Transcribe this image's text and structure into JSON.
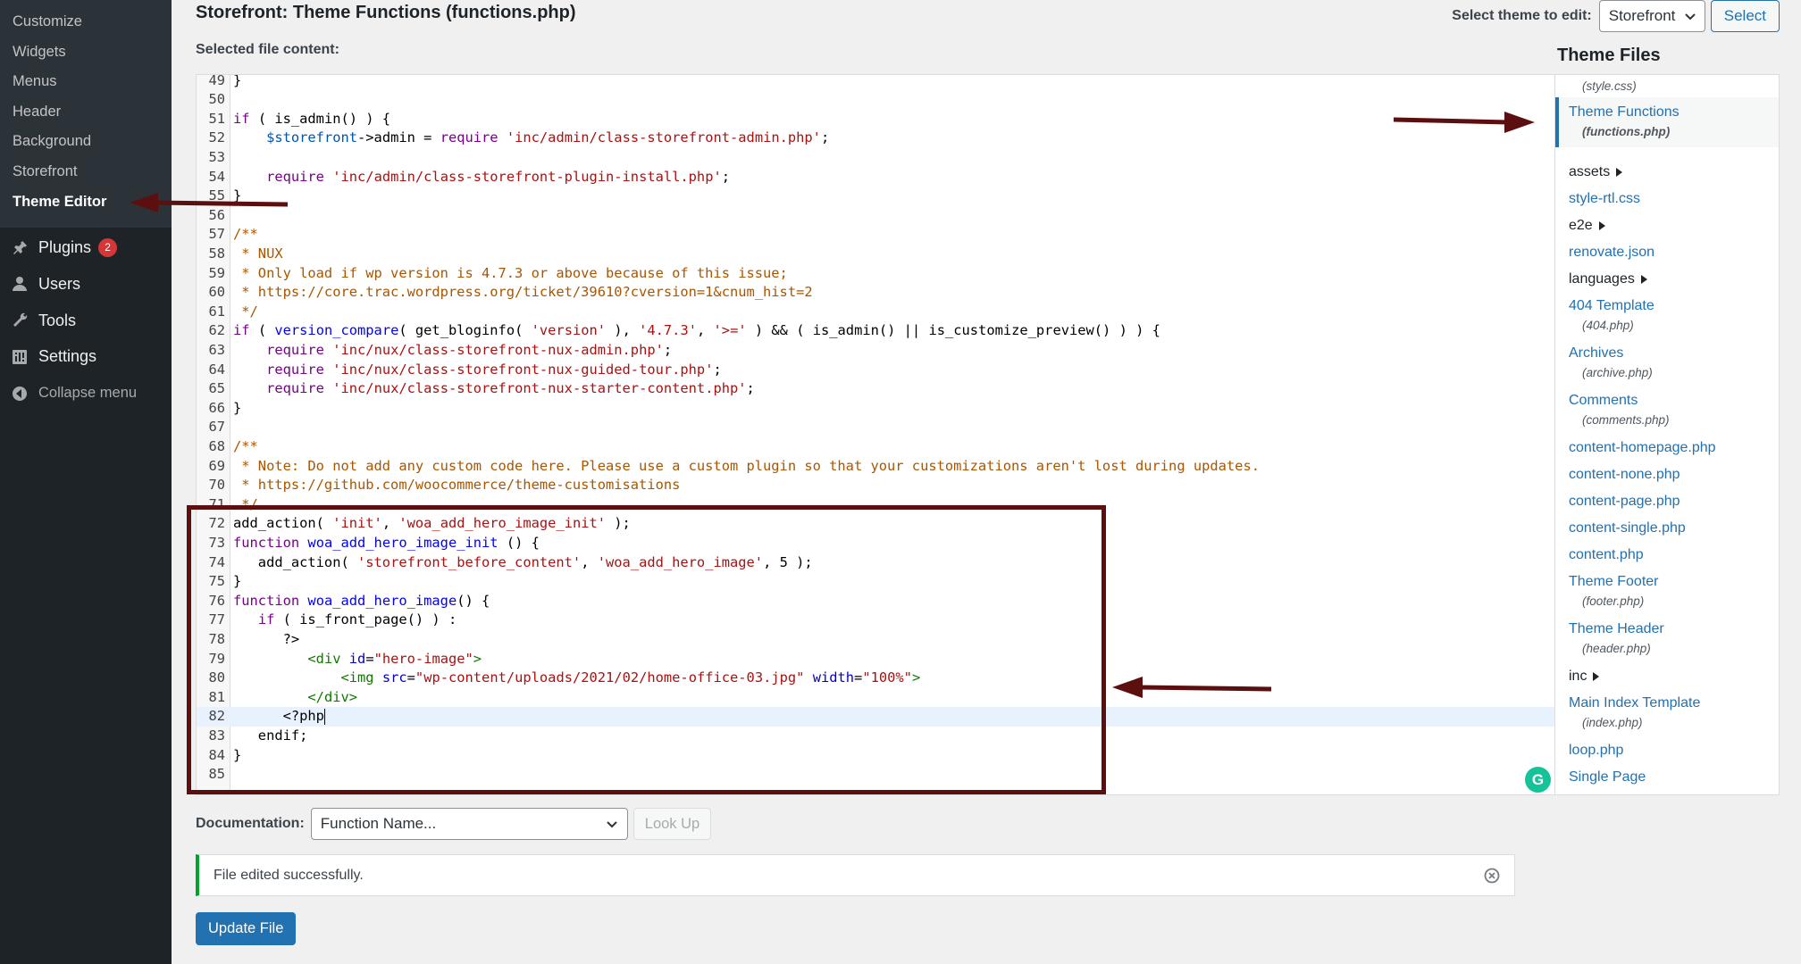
{
  "sidebar": {
    "sub_items": [
      {
        "label": "Customize",
        "current": false
      },
      {
        "label": "Widgets",
        "current": false
      },
      {
        "label": "Menus",
        "current": false
      },
      {
        "label": "Header",
        "current": false
      },
      {
        "label": "Background",
        "current": false
      },
      {
        "label": "Storefront",
        "current": false
      },
      {
        "label": "Theme Editor",
        "current": true
      }
    ],
    "main_items": [
      {
        "label": "Plugins",
        "icon": "plugins-icon",
        "badge": "2"
      },
      {
        "label": "Users",
        "icon": "users-icon"
      },
      {
        "label": "Tools",
        "icon": "tools-icon"
      },
      {
        "label": "Settings",
        "icon": "settings-icon"
      },
      {
        "label": "Collapse menu",
        "icon": "collapse-icon"
      }
    ]
  },
  "header": {
    "title": "Storefront: Theme Functions (functions.php)",
    "selected_label": "Selected file content:",
    "theme_select_label": "Select theme to edit:",
    "theme_select_value": "Storefront",
    "select_button": "Select"
  },
  "editor": {
    "active_line": "82",
    "lines": [
      {
        "n": "49",
        "t": [
          [
            "op",
            "}"
          ]
        ]
      },
      {
        "n": "50",
        "t": []
      },
      {
        "n": "51",
        "t": [
          [
            "kw",
            "if"
          ],
          [
            "op",
            " ( is_admin() ) {"
          ]
        ]
      },
      {
        "n": "52",
        "t": [
          [
            "op",
            "    "
          ],
          [
            "var",
            "$storefront"
          ],
          [
            "op",
            "->admin = "
          ],
          [
            "kw",
            "require"
          ],
          [
            "op",
            " "
          ],
          [
            "str",
            "'inc/admin/class-storefront-admin.php'"
          ],
          [
            "op",
            ";"
          ]
        ]
      },
      {
        "n": "53",
        "t": []
      },
      {
        "n": "54",
        "t": [
          [
            "op",
            "    "
          ],
          [
            "kw",
            "require"
          ],
          [
            "op",
            " "
          ],
          [
            "str",
            "'inc/admin/class-storefront-plugin-install.php'"
          ],
          [
            "op",
            ";"
          ]
        ]
      },
      {
        "n": "55",
        "t": [
          [
            "op",
            "}"
          ]
        ]
      },
      {
        "n": "56",
        "t": []
      },
      {
        "n": "57",
        "t": [
          [
            "cm",
            "/**"
          ]
        ]
      },
      {
        "n": "58",
        "t": [
          [
            "cm",
            " * NUX"
          ]
        ]
      },
      {
        "n": "59",
        "t": [
          [
            "cm",
            " * Only load if wp version is 4.7.3 or above because of this issue;"
          ]
        ]
      },
      {
        "n": "60",
        "t": [
          [
            "cm",
            " * https://core.trac.wordpress.org/ticket/39610?cversion=1&cnum_hist=2"
          ]
        ]
      },
      {
        "n": "61",
        "t": [
          [
            "cm",
            " */"
          ]
        ]
      },
      {
        "n": "62",
        "t": [
          [
            "kw",
            "if"
          ],
          [
            "op",
            " ( "
          ],
          [
            "fn",
            "version_compare"
          ],
          [
            "op",
            "( get_bloginfo( "
          ],
          [
            "str",
            "'version'"
          ],
          [
            "op",
            " ), "
          ],
          [
            "str",
            "'4.7.3'"
          ],
          [
            "op",
            ", "
          ],
          [
            "str",
            "'>='"
          ],
          [
            "op",
            " ) && ( is_admin() || is_customize_preview() ) ) {"
          ]
        ]
      },
      {
        "n": "63",
        "t": [
          [
            "op",
            "    "
          ],
          [
            "kw",
            "require"
          ],
          [
            "op",
            " "
          ],
          [
            "str",
            "'inc/nux/class-storefront-nux-admin.php'"
          ],
          [
            "op",
            ";"
          ]
        ]
      },
      {
        "n": "64",
        "t": [
          [
            "op",
            "    "
          ],
          [
            "kw",
            "require"
          ],
          [
            "op",
            " "
          ],
          [
            "str",
            "'inc/nux/class-storefront-nux-guided-tour.php'"
          ],
          [
            "op",
            ";"
          ]
        ]
      },
      {
        "n": "65",
        "t": [
          [
            "op",
            "    "
          ],
          [
            "kw",
            "require"
          ],
          [
            "op",
            " "
          ],
          [
            "str",
            "'inc/nux/class-storefront-nux-starter-content.php'"
          ],
          [
            "op",
            ";"
          ]
        ]
      },
      {
        "n": "66",
        "t": [
          [
            "op",
            "}"
          ]
        ]
      },
      {
        "n": "67",
        "t": []
      },
      {
        "n": "68",
        "t": [
          [
            "cm",
            "/**"
          ]
        ]
      },
      {
        "n": "69",
        "t": [
          [
            "cm",
            " * Note: Do not add any custom code here. Please use a custom plugin so that your customizations aren't lost during updates."
          ]
        ]
      },
      {
        "n": "70",
        "t": [
          [
            "cm",
            " * https://github.com/woocommerce/theme-customisations"
          ]
        ]
      },
      {
        "n": "71",
        "t": [
          [
            "cm",
            " */"
          ]
        ]
      },
      {
        "n": "72",
        "t": [
          [
            "op",
            "add_action( "
          ],
          [
            "str",
            "'init'"
          ],
          [
            "op",
            ", "
          ],
          [
            "str",
            "'woa_add_hero_image_init'"
          ],
          [
            "op",
            " );"
          ]
        ]
      },
      {
        "n": "73",
        "t": [
          [
            "kw",
            "function"
          ],
          [
            "op",
            " "
          ],
          [
            "fn",
            "woa_add_hero_image_init"
          ],
          [
            "op",
            " () {"
          ]
        ]
      },
      {
        "n": "74",
        "t": [
          [
            "op",
            "   add_action( "
          ],
          [
            "str",
            "'storefront_before_content'"
          ],
          [
            "op",
            ", "
          ],
          [
            "str",
            "'woa_add_hero_image'"
          ],
          [
            "op",
            ", 5 );"
          ]
        ]
      },
      {
        "n": "75",
        "t": [
          [
            "op",
            "}"
          ]
        ]
      },
      {
        "n": "76",
        "t": [
          [
            "kw",
            "function"
          ],
          [
            "op",
            " "
          ],
          [
            "fn",
            "woa_add_hero_image"
          ],
          [
            "op",
            "() {"
          ]
        ]
      },
      {
        "n": "77",
        "t": [
          [
            "op",
            "   "
          ],
          [
            "kw",
            "if"
          ],
          [
            "op",
            " ( is_front_page() ) :"
          ]
        ]
      },
      {
        "n": "78",
        "t": [
          [
            "op",
            "      ?>"
          ]
        ]
      },
      {
        "n": "79",
        "t": [
          [
            "op",
            "         "
          ],
          [
            "tag",
            "<div"
          ],
          [
            "op",
            " "
          ],
          [
            "attr",
            "id"
          ],
          [
            "op",
            "="
          ],
          [
            "str",
            "\"hero-image\""
          ],
          [
            "tag",
            ">"
          ]
        ]
      },
      {
        "n": "80",
        "t": [
          [
            "op",
            "             "
          ],
          [
            "tag",
            "<img"
          ],
          [
            "op",
            " "
          ],
          [
            "attr",
            "src"
          ],
          [
            "op",
            "="
          ],
          [
            "str",
            "\"wp-content/uploads/2021/02/home-office-03.jpg\""
          ],
          [
            "op",
            " "
          ],
          [
            "attr",
            "width"
          ],
          [
            "op",
            "="
          ],
          [
            "str",
            "\"100%\""
          ],
          [
            "tag",
            ">"
          ]
        ]
      },
      {
        "n": "81",
        "t": [
          [
            "op",
            "         "
          ],
          [
            "tag",
            "</div>"
          ]
        ]
      },
      {
        "n": "82",
        "t": [
          [
            "op",
            "      <?php"
          ]
        ]
      },
      {
        "n": "83",
        "t": [
          [
            "op",
            "   endif;"
          ]
        ]
      },
      {
        "n": "84",
        "t": [
          [
            "op",
            "}"
          ]
        ]
      },
      {
        "n": "85",
        "t": []
      }
    ]
  },
  "theme_files": {
    "title": "Theme Files",
    "items": [
      {
        "type": "sub-only",
        "sub": "(style.css)"
      },
      {
        "type": "current",
        "name": "Theme Functions",
        "sub": "(functions.php)"
      },
      {
        "type": "dir",
        "name": "assets"
      },
      {
        "type": "file",
        "name": "style-rtl.css"
      },
      {
        "type": "dir",
        "name": "e2e"
      },
      {
        "type": "file",
        "name": "renovate.json"
      },
      {
        "type": "dir",
        "name": "languages"
      },
      {
        "type": "file",
        "name": "404 Template",
        "sub": "(404.php)"
      },
      {
        "type": "file",
        "name": "Archives",
        "sub": "(archive.php)"
      },
      {
        "type": "file",
        "name": "Comments",
        "sub": "(comments.php)"
      },
      {
        "type": "file",
        "name": "content-homepage.php"
      },
      {
        "type": "file",
        "name": "content-none.php"
      },
      {
        "type": "file",
        "name": "content-page.php"
      },
      {
        "type": "file",
        "name": "content-single.php"
      },
      {
        "type": "file",
        "name": "content.php"
      },
      {
        "type": "file",
        "name": "Theme Footer",
        "sub": "(footer.php)"
      },
      {
        "type": "file",
        "name": "Theme Header",
        "sub": "(header.php)"
      },
      {
        "type": "dir",
        "name": "inc"
      },
      {
        "type": "file",
        "name": "Main Index Template",
        "sub": "(index.php)"
      },
      {
        "type": "file",
        "name": "loop.php"
      },
      {
        "type": "file",
        "name": "Single Page"
      }
    ]
  },
  "documentation": {
    "label": "Documentation:",
    "select_value": "Function Name...",
    "lookup_button": "Look Up"
  },
  "notice": {
    "text": "File edited successfully."
  },
  "update_button": "Update File",
  "colors": {
    "sidebar_bg": "#1d2327",
    "accent": "#2271b1",
    "success": "#00a32a",
    "badge": "#d63638",
    "annotation": "#5c0f0f"
  }
}
